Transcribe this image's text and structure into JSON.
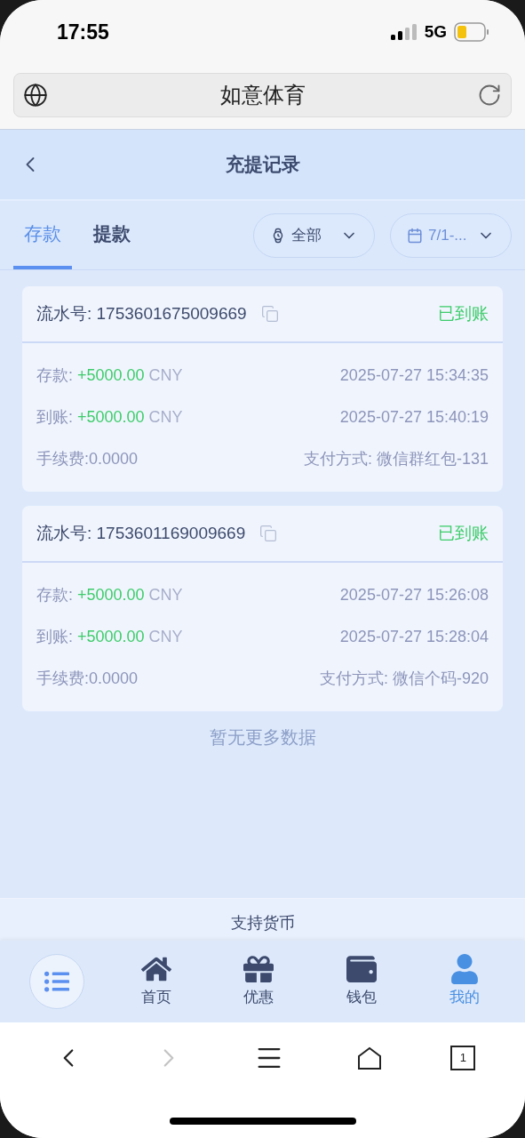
{
  "status_bar": {
    "time": "17:55",
    "network": "5G"
  },
  "address_bar": {
    "title": "如意体育"
  },
  "header": {
    "title": "充提记录"
  },
  "tabs": [
    {
      "label": "存款",
      "selected": true
    },
    {
      "label": "提款",
      "selected": false
    }
  ],
  "filters": [
    {
      "kind": "status",
      "value": "全部"
    },
    {
      "kind": "date",
      "value": "7/1-..."
    }
  ],
  "records": [
    {
      "serial_label": "流水号: 1753601675009669",
      "status": "已到账",
      "rows": [
        {
          "kind": "amount",
          "label": "存款: ",
          "amount": "+5000.00",
          "unit": " CNY",
          "right": "2025-07-27 15:34:35"
        },
        {
          "kind": "amount",
          "label": "到账: ",
          "amount": "+5000.00",
          "unit": " CNY",
          "right": "2025-07-27 15:40:19"
        },
        {
          "kind": "fee",
          "label": "手续费:0.0000",
          "right": "支付方式: 微信群红包-131"
        }
      ]
    },
    {
      "serial_label": "流水号: 1753601169009669",
      "status": "已到账",
      "rows": [
        {
          "kind": "amount",
          "label": "存款: ",
          "amount": "+5000.00",
          "unit": " CNY",
          "right": "2025-07-27 15:26:08"
        },
        {
          "kind": "amount",
          "label": "到账: ",
          "amount": "+5000.00",
          "unit": " CNY",
          "right": "2025-07-27 15:28:04"
        },
        {
          "kind": "fee",
          "label": "手续费:0.0000",
          "right": "支付方式: 微信个码-920"
        }
      ]
    }
  ],
  "end_note": "暂无更多数据",
  "footer_label": "支持货币",
  "bottom_nav": [
    {
      "kind": "menu",
      "selected": false
    },
    {
      "kind": "home",
      "label": "首页",
      "selected": false
    },
    {
      "kind": "gift",
      "label": "优惠",
      "selected": false
    },
    {
      "kind": "wallet",
      "label": "钱包",
      "selected": false
    },
    {
      "kind": "user",
      "label": "我的",
      "selected": true
    }
  ],
  "browser_toolbar": [
    {
      "kind": "back",
      "disabled": false
    },
    {
      "kind": "forward",
      "disabled": true
    },
    {
      "kind": "menu",
      "disabled": false
    },
    {
      "kind": "home",
      "disabled": false
    },
    {
      "kind": "tabs",
      "disabled": false,
      "count": "1"
    }
  ]
}
